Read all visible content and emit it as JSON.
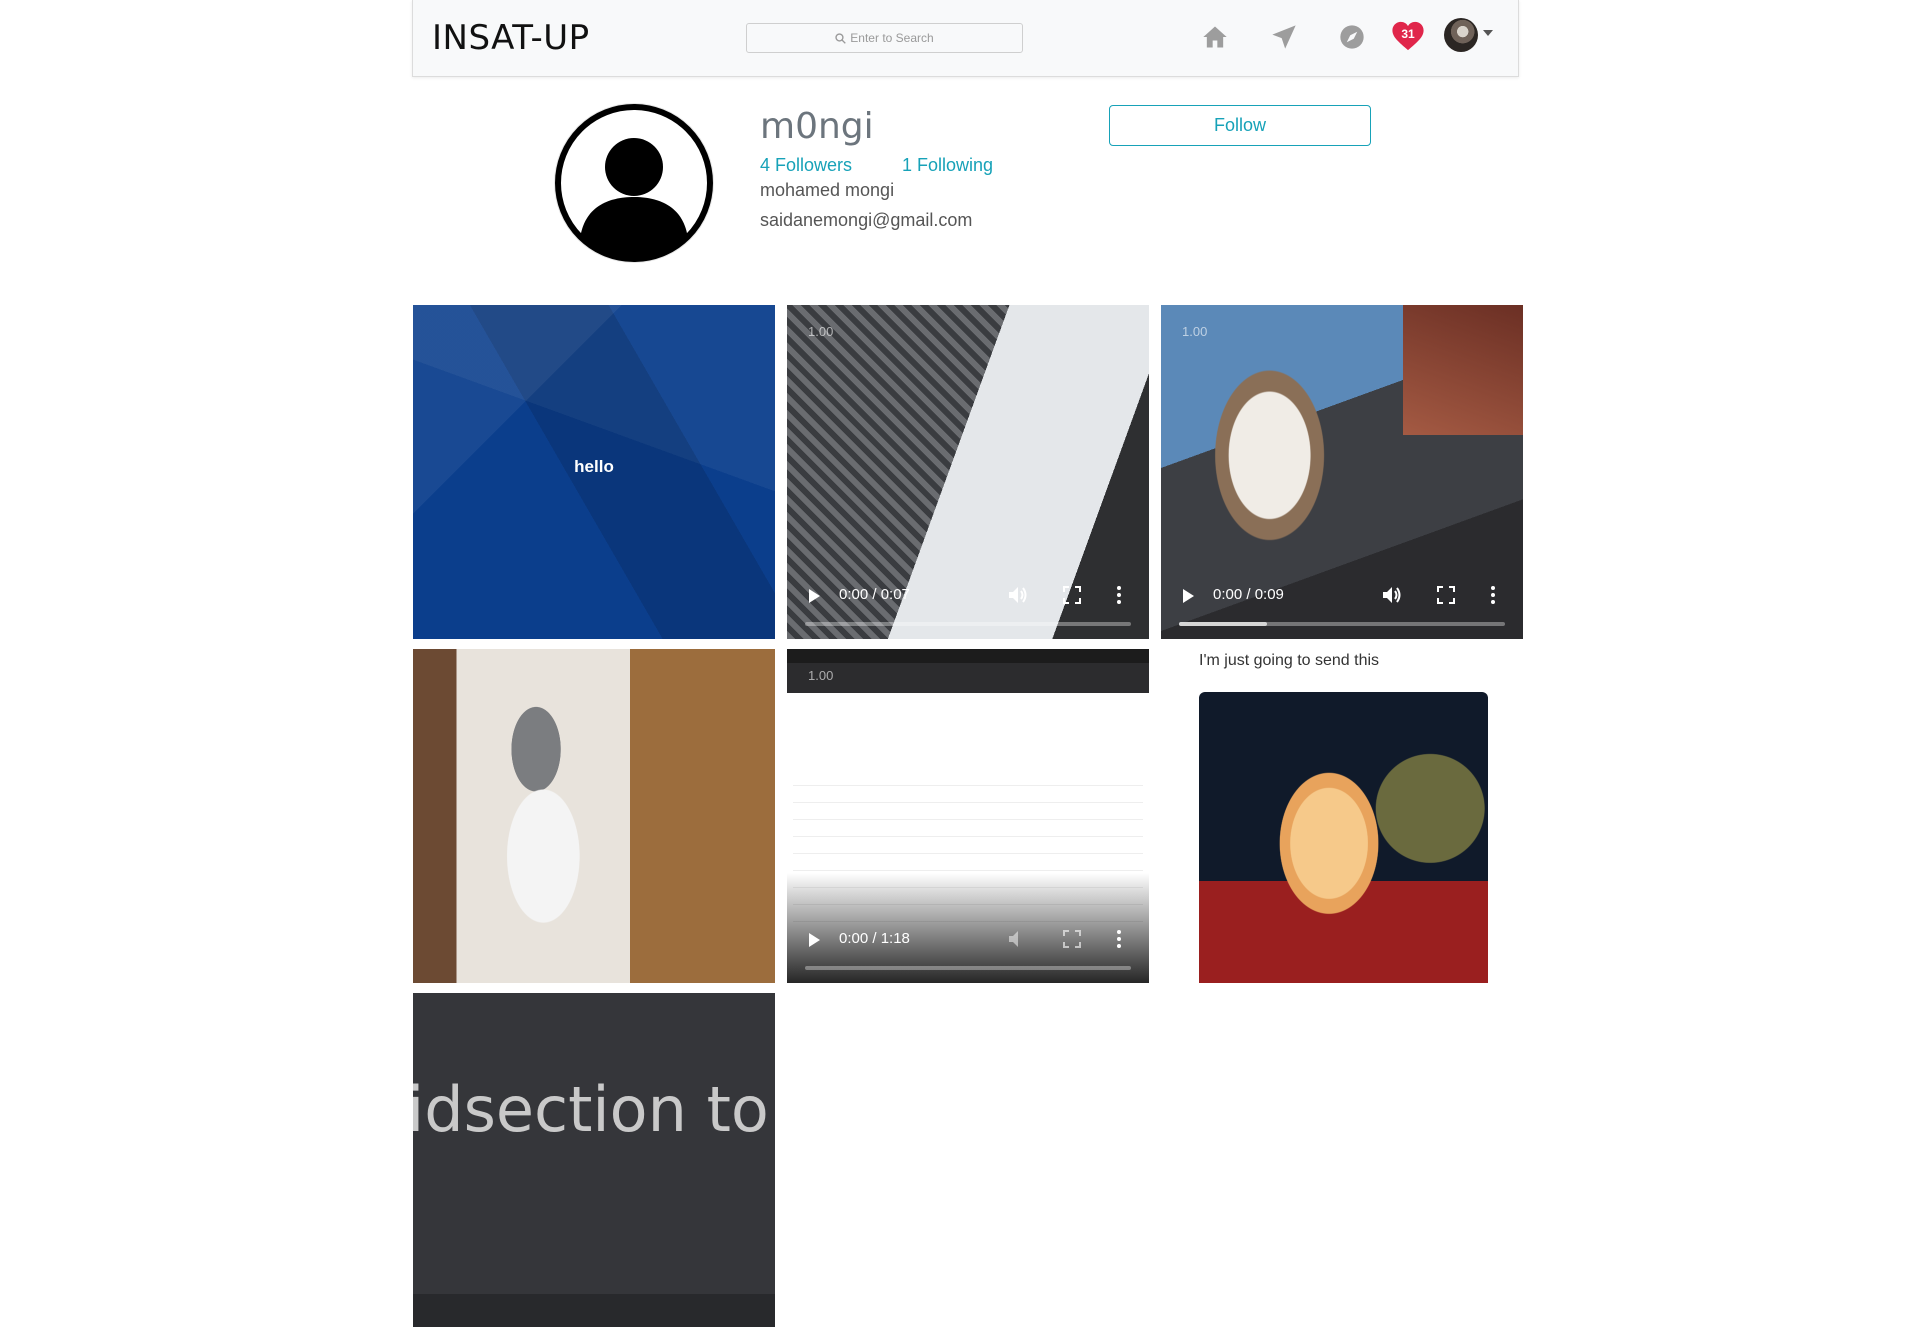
{
  "header": {
    "brand": "INSAT-UP",
    "search_placeholder": "Enter to Search",
    "icons": [
      "home-icon",
      "send-icon",
      "explore-icon",
      "heart-icon",
      "avatar"
    ],
    "notification_count": "31",
    "accent_color": "#17a2b8",
    "heart_color": "#e0264a"
  },
  "profile": {
    "username": "m0ngi",
    "followers_label": "4 Followers",
    "following_label": "1 Following",
    "full_name": "mohamed mongi",
    "email": "saidanemongi@gmail.com",
    "follow_button": "Follow"
  },
  "posts": [
    {
      "type": "text",
      "text": "hello"
    },
    {
      "type": "video",
      "rate": "1.00",
      "time": "0:00 / 0:07",
      "buffered": 0
    },
    {
      "type": "video",
      "rate": "1.00",
      "time": "0:00 / 0:09",
      "buffered": 0.27
    },
    {
      "type": "image"
    },
    {
      "type": "video",
      "rate": "1.00",
      "time": "0:00 / 1:18",
      "buffered": 0
    },
    {
      "type": "image",
      "caption": "I'm just going to send this"
    },
    {
      "type": "image",
      "text": "idsection to"
    }
  ]
}
